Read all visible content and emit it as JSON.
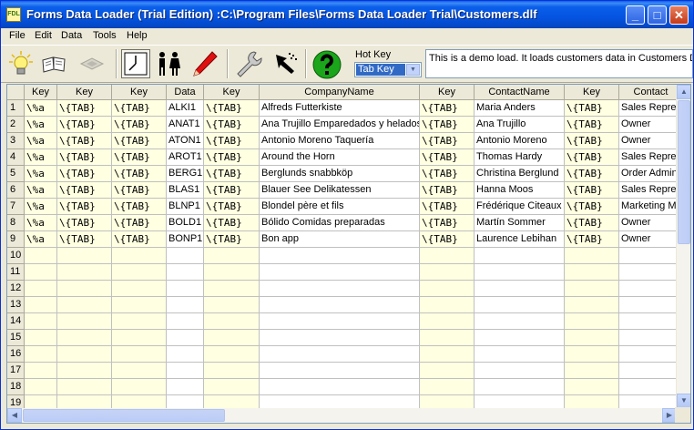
{
  "window": {
    "title": "Forms Data Loader (Trial Edition) :C:\\Program Files\\Forms Data Loader Trial\\Customers.dlf",
    "icon_text": "FDL",
    "minimize": "_",
    "maximize": "□",
    "close": "✕"
  },
  "menu": [
    {
      "label": "File"
    },
    {
      "label": "Edit"
    },
    {
      "label": "Data"
    },
    {
      "label": "Tools"
    },
    {
      "label": "Help"
    }
  ],
  "toolbar": {
    "icons": [
      "lightbulb-icon",
      "open-book-icon",
      "disabled-tool-icon",
      "clock-icon",
      "people-icon",
      "pencil-icon",
      "wrench-icon",
      "hand-cursor-icon",
      "help-icon"
    ]
  },
  "hotkey": {
    "label": "Hot Key",
    "value": "Tab Key"
  },
  "description": "This is a demo load. It loads customers data in Customers Der",
  "grid": {
    "columns": [
      {
        "header": "Key"
      },
      {
        "header": "Key"
      },
      {
        "header": "Key"
      },
      {
        "header": "Data"
      },
      {
        "header": "Key"
      },
      {
        "header": "CompanyName"
      },
      {
        "header": "Key"
      },
      {
        "header": "ContactName"
      },
      {
        "header": "Key"
      },
      {
        "header": "Contact"
      }
    ],
    "row_numbers": [
      "1",
      "2",
      "3",
      "4",
      "5",
      "6",
      "7",
      "8",
      "9",
      "10",
      "11",
      "12",
      "13",
      "14",
      "15",
      "16",
      "17",
      "18",
      "19"
    ],
    "rows": [
      [
        "\\%a",
        "\\{TAB}",
        "\\{TAB}",
        "ALKI1",
        "\\{TAB}",
        "Alfreds Futterkiste",
        "\\{TAB}",
        "Maria Anders",
        "\\{TAB}",
        "Sales Representative"
      ],
      [
        "\\%a",
        "\\{TAB}",
        "\\{TAB}",
        "ANAT1",
        "\\{TAB}",
        "Ana Trujillo Emparedados y helados",
        "\\{TAB}",
        "Ana Trujillo",
        "\\{TAB}",
        "Owner"
      ],
      [
        "\\%a",
        "\\{TAB}",
        "\\{TAB}",
        "ATON1",
        "\\{TAB}",
        "Antonio Moreno Taquería",
        "\\{TAB}",
        "Antonio Moreno",
        "\\{TAB}",
        "Owner"
      ],
      [
        "\\%a",
        "\\{TAB}",
        "\\{TAB}",
        "AROT1",
        "\\{TAB}",
        "Around the Horn",
        "\\{TAB}",
        "Thomas Hardy",
        "\\{TAB}",
        "Sales Representative"
      ],
      [
        "\\%a",
        "\\{TAB}",
        "\\{TAB}",
        "BERG1",
        "\\{TAB}",
        "Berglunds snabbköp",
        "\\{TAB}",
        "Christina Berglund",
        "\\{TAB}",
        "Order Administrator"
      ],
      [
        "\\%a",
        "\\{TAB}",
        "\\{TAB}",
        "BLAS1",
        "\\{TAB}",
        "Blauer See Delikatessen",
        "\\{TAB}",
        "Hanna Moos",
        "\\{TAB}",
        "Sales Representative"
      ],
      [
        "\\%a",
        "\\{TAB}",
        "\\{TAB}",
        "BLNP1",
        "\\{TAB}",
        "Blondel père et fils",
        "\\{TAB}",
        "Frédérique Citeaux",
        "\\{TAB}",
        "Marketing Manager"
      ],
      [
        "\\%a",
        "\\{TAB}",
        "\\{TAB}",
        "BOLD1",
        "\\{TAB}",
        "Bólido Comidas preparadas",
        "\\{TAB}",
        "Martín Sommer",
        "\\{TAB}",
        "Owner"
      ],
      [
        "\\%a",
        "\\{TAB}",
        "\\{TAB}",
        "BONP1",
        "\\{TAB}",
        "Bon app",
        "\\{TAB}",
        "Laurence Lebihan",
        "\\{TAB}",
        "Owner"
      ]
    ]
  },
  "scroll": {
    "up": "▲",
    "down": "▼",
    "left": "◀",
    "right": "▶"
  },
  "colors": {
    "key_cell_bg": "#ffffe1",
    "title_bar": "#0554e1",
    "selection": "#316ac5"
  }
}
